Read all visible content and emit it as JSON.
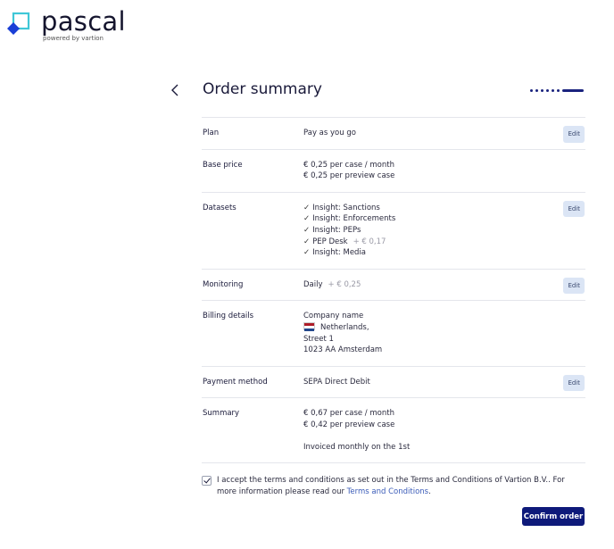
{
  "brand": {
    "name": "pascal",
    "tagline": "powered by vartion",
    "colors": {
      "mark_outline": "#3fc7d7",
      "mark_fill": "#1a3fd6",
      "accent": "#0e1a7a"
    }
  },
  "header": {
    "back_icon": "chevron-left-icon",
    "title": "Order summary",
    "progress": {
      "steps_done": 6,
      "current": 7,
      "total": 7
    }
  },
  "rows": [
    {
      "label": "Plan",
      "lines": [
        "Pay as you go"
      ],
      "edit": "Edit"
    },
    {
      "label": "Base price",
      "lines": [
        "€ 0,25 per case / month",
        "€ 0,25 per preview case"
      ]
    },
    {
      "label": "Datasets",
      "check_icon": "✓",
      "items": [
        {
          "name": "Insight: Sanctions",
          "extra": ""
        },
        {
          "name": "Insight: Enforcements",
          "extra": ""
        },
        {
          "name": "Insight: PEPs",
          "extra": ""
        },
        {
          "name": "PEP Desk",
          "extra": "+ € 0,17"
        },
        {
          "name": "Insight: Media",
          "extra": ""
        }
      ],
      "edit": "Edit"
    },
    {
      "label": "Monitoring",
      "value": "Daily",
      "extra": "+ € 0,25",
      "edit": "Edit"
    },
    {
      "label": "Billing details",
      "company": "Company name",
      "country": "Netherlands,",
      "street": "Street 1",
      "city": "1023 AA Amsterdam",
      "flag_icon": "netherlands-flag-icon"
    },
    {
      "label": "Payment method",
      "lines": [
        "SEPA Direct Debit"
      ],
      "edit": "Edit"
    },
    {
      "label": "Summary",
      "lines": [
        "€ 0,67 per case / month",
        "€ 0,42 per preview case"
      ],
      "note": "Invoiced monthly on the 1st"
    }
  ],
  "terms": {
    "checked": true,
    "text": "I accept the terms and conditions as set out in the Terms and Conditions of Vartion B.V.. For more information please read our ",
    "link": "Terms and Conditions",
    "end": "."
  },
  "confirm_label": "Confirm order"
}
